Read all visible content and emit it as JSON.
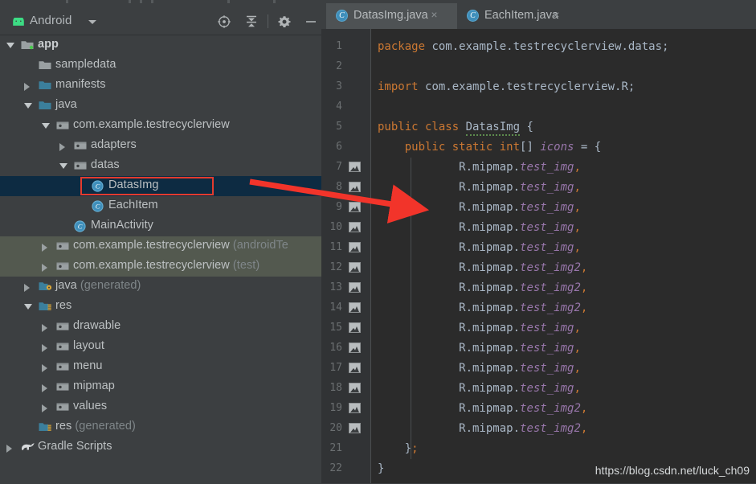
{
  "window": {
    "tool_window_title": "Android",
    "run_status_indicator": "green-dot"
  },
  "toolbar": {
    "buttons": [
      {
        "name": "locate-target-icon",
        "tooltip": "Select Opened File"
      },
      {
        "name": "collapse-all-icon",
        "tooltip": "Collapse All"
      },
      {
        "name": "settings-gear-icon",
        "tooltip": "Settings"
      },
      {
        "name": "minimize-icon",
        "tooltip": "Hide"
      }
    ]
  },
  "tree": {
    "nodes": [
      {
        "label": "app",
        "suffix": "",
        "indent": 0,
        "arrow": "expanded",
        "icon": "folder-module",
        "bold": true,
        "state": "normal"
      },
      {
        "label": "sampledata",
        "suffix": "",
        "indent": 1,
        "arrow": "none",
        "icon": "folder-gray",
        "bold": false,
        "state": "normal"
      },
      {
        "label": "manifests",
        "suffix": "",
        "indent": 1,
        "arrow": "collapsed",
        "icon": "folder-blue",
        "bold": false,
        "state": "normal"
      },
      {
        "label": "java",
        "suffix": "",
        "indent": 1,
        "arrow": "expanded",
        "icon": "folder-blue",
        "bold": false,
        "state": "normal"
      },
      {
        "label": "com.example.testrecyclerview",
        "suffix": "",
        "indent": 2,
        "arrow": "expanded",
        "icon": "package",
        "bold": false,
        "state": "normal"
      },
      {
        "label": "adapters",
        "suffix": "",
        "indent": 3,
        "arrow": "collapsed",
        "icon": "package",
        "bold": false,
        "state": "normal"
      },
      {
        "label": "datas",
        "suffix": "",
        "indent": 3,
        "arrow": "expanded",
        "icon": "package",
        "bold": false,
        "state": "normal"
      },
      {
        "label": "DatasImg",
        "suffix": "",
        "indent": 4,
        "arrow": "none",
        "icon": "java-class",
        "bold": false,
        "state": "selected"
      },
      {
        "label": "EachItem",
        "suffix": "",
        "indent": 4,
        "arrow": "none",
        "icon": "java-class",
        "bold": false,
        "state": "normal"
      },
      {
        "label": "MainActivity",
        "suffix": "",
        "indent": 3,
        "arrow": "none",
        "icon": "java-class",
        "bold": false,
        "state": "normal"
      },
      {
        "label": "com.example.testrecyclerview",
        "suffix": " (androidTe",
        "indent": 2,
        "arrow": "collapsed",
        "icon": "package",
        "bold": false,
        "state": "test-scope"
      },
      {
        "label": "com.example.testrecyclerview",
        "suffix": " (test)",
        "indent": 2,
        "arrow": "collapsed",
        "icon": "package",
        "bold": false,
        "state": "test-scope"
      },
      {
        "label": "java",
        "suffix": " (generated)",
        "indent": 1,
        "arrow": "collapsed",
        "icon": "folder-generated",
        "bold": false,
        "state": "normal"
      },
      {
        "label": "res",
        "suffix": "",
        "indent": 1,
        "arrow": "expanded",
        "icon": "folder-res",
        "bold": false,
        "state": "normal"
      },
      {
        "label": "drawable",
        "suffix": "",
        "indent": 2,
        "arrow": "collapsed",
        "icon": "package",
        "bold": false,
        "state": "normal"
      },
      {
        "label": "layout",
        "suffix": "",
        "indent": 2,
        "arrow": "collapsed",
        "icon": "package",
        "bold": false,
        "state": "normal"
      },
      {
        "label": "menu",
        "suffix": "",
        "indent": 2,
        "arrow": "collapsed",
        "icon": "package",
        "bold": false,
        "state": "normal"
      },
      {
        "label": "mipmap",
        "suffix": "",
        "indent": 2,
        "arrow": "collapsed",
        "icon": "package",
        "bold": false,
        "state": "normal"
      },
      {
        "label": "values",
        "suffix": "",
        "indent": 2,
        "arrow": "collapsed",
        "icon": "package",
        "bold": false,
        "state": "normal"
      },
      {
        "label": "res",
        "suffix": " (generated)",
        "indent": 1,
        "arrow": "none",
        "icon": "folder-res",
        "bold": false,
        "state": "normal"
      },
      {
        "label": "Gradle Scripts",
        "suffix": "",
        "indent": 0,
        "arrow": "collapsed",
        "icon": "gradle",
        "bold": false,
        "state": "normal"
      }
    ]
  },
  "editor": {
    "tabs": [
      {
        "label": "DatasImg.java",
        "icon": "java-class-icon",
        "active": true,
        "close": "×"
      },
      {
        "label": "EachItem.java",
        "icon": "java-class-icon",
        "active": false,
        "close": "×"
      }
    ],
    "lines": [
      {
        "no": "1",
        "gutter_icon": false,
        "tokens": [
          {
            "t": "package ",
            "c": "kw"
          },
          {
            "t": "com.example.testrecyclerview.datas;",
            "c": "plain"
          }
        ]
      },
      {
        "no": "2",
        "gutter_icon": false,
        "tokens": []
      },
      {
        "no": "3",
        "gutter_icon": false,
        "tokens": [
          {
            "t": "import ",
            "c": "kw"
          },
          {
            "t": "com.example.testrecyclerview.R;",
            "c": "plain"
          }
        ]
      },
      {
        "no": "4",
        "gutter_icon": false,
        "tokens": []
      },
      {
        "no": "5",
        "gutter_icon": false,
        "tokens": [
          {
            "t": "public class ",
            "c": "kw"
          },
          {
            "t": "DatasImg",
            "c": "cls-decl"
          },
          {
            "t": " {",
            "c": "plain"
          }
        ]
      },
      {
        "no": "6",
        "gutter_icon": false,
        "tokens": [
          {
            "t": "    public static int",
            "c": "kw"
          },
          {
            "t": "[] ",
            "c": "plain"
          },
          {
            "t": "icons",
            "c": "fld"
          },
          {
            "t": " = {",
            "c": "plain"
          }
        ]
      },
      {
        "no": "7",
        "gutter_icon": true,
        "tokens": [
          {
            "t": "            R.mipmap.",
            "c": "plain"
          },
          {
            "t": "test_img",
            "c": "fld"
          },
          {
            "t": ",",
            "c": "punc"
          }
        ]
      },
      {
        "no": "8",
        "gutter_icon": true,
        "tokens": [
          {
            "t": "            R.mipmap.",
            "c": "plain"
          },
          {
            "t": "test_img",
            "c": "fld"
          },
          {
            "t": ",",
            "c": "punc"
          }
        ]
      },
      {
        "no": "9",
        "gutter_icon": true,
        "tokens": [
          {
            "t": "            R.mipmap.",
            "c": "plain"
          },
          {
            "t": "test_img",
            "c": "fld"
          },
          {
            "t": ",",
            "c": "punc"
          }
        ]
      },
      {
        "no": "10",
        "gutter_icon": true,
        "tokens": [
          {
            "t": "            R.mipmap.",
            "c": "plain"
          },
          {
            "t": "test_img",
            "c": "fld"
          },
          {
            "t": ",",
            "c": "punc"
          }
        ]
      },
      {
        "no": "11",
        "gutter_icon": true,
        "tokens": [
          {
            "t": "            R.mipmap.",
            "c": "plain"
          },
          {
            "t": "test_img",
            "c": "fld"
          },
          {
            "t": ",",
            "c": "punc"
          }
        ]
      },
      {
        "no": "12",
        "gutter_icon": true,
        "tokens": [
          {
            "t": "            R.mipmap.",
            "c": "plain"
          },
          {
            "t": "test_img2",
            "c": "fld"
          },
          {
            "t": ",",
            "c": "punc"
          }
        ]
      },
      {
        "no": "13",
        "gutter_icon": true,
        "tokens": [
          {
            "t": "            R.mipmap.",
            "c": "plain"
          },
          {
            "t": "test_img2",
            "c": "fld"
          },
          {
            "t": ",",
            "c": "punc"
          }
        ]
      },
      {
        "no": "14",
        "gutter_icon": true,
        "tokens": [
          {
            "t": "            R.mipmap.",
            "c": "plain"
          },
          {
            "t": "test_img2",
            "c": "fld"
          },
          {
            "t": ",",
            "c": "punc"
          }
        ]
      },
      {
        "no": "15",
        "gutter_icon": true,
        "tokens": [
          {
            "t": "            R.mipmap.",
            "c": "plain"
          },
          {
            "t": "test_img",
            "c": "fld"
          },
          {
            "t": ",",
            "c": "punc"
          }
        ]
      },
      {
        "no": "16",
        "gutter_icon": true,
        "tokens": [
          {
            "t": "            R.mipmap.",
            "c": "plain"
          },
          {
            "t": "test_img",
            "c": "fld"
          },
          {
            "t": ",",
            "c": "punc"
          }
        ]
      },
      {
        "no": "17",
        "gutter_icon": true,
        "tokens": [
          {
            "t": "            R.mipmap.",
            "c": "plain"
          },
          {
            "t": "test_img",
            "c": "fld"
          },
          {
            "t": ",",
            "c": "punc"
          }
        ]
      },
      {
        "no": "18",
        "gutter_icon": true,
        "tokens": [
          {
            "t": "            R.mipmap.",
            "c": "plain"
          },
          {
            "t": "test_img",
            "c": "fld"
          },
          {
            "t": ",",
            "c": "punc"
          }
        ]
      },
      {
        "no": "19",
        "gutter_icon": true,
        "tokens": [
          {
            "t": "            R.mipmap.",
            "c": "plain"
          },
          {
            "t": "test_img2",
            "c": "fld"
          },
          {
            "t": ",",
            "c": "punc"
          }
        ]
      },
      {
        "no": "20",
        "gutter_icon": true,
        "tokens": [
          {
            "t": "            R.mipmap.",
            "c": "plain"
          },
          {
            "t": "test_img2",
            "c": "fld"
          },
          {
            "t": ",",
            "c": "punc"
          }
        ]
      },
      {
        "no": "21",
        "gutter_icon": false,
        "tokens": [
          {
            "t": "    }",
            "c": "plain"
          },
          {
            "t": ";",
            "c": "punc"
          }
        ]
      },
      {
        "no": "22",
        "gutter_icon": false,
        "tokens": [
          {
            "t": "}",
            "c": "plain"
          }
        ]
      }
    ]
  },
  "watermark": {
    "text": "https://blog.csdn.net/luck_ch09"
  },
  "annotation": {
    "highlight_target": "DatasImg",
    "arrow_color": "#f2342a",
    "box_color": "#e33b2e"
  }
}
